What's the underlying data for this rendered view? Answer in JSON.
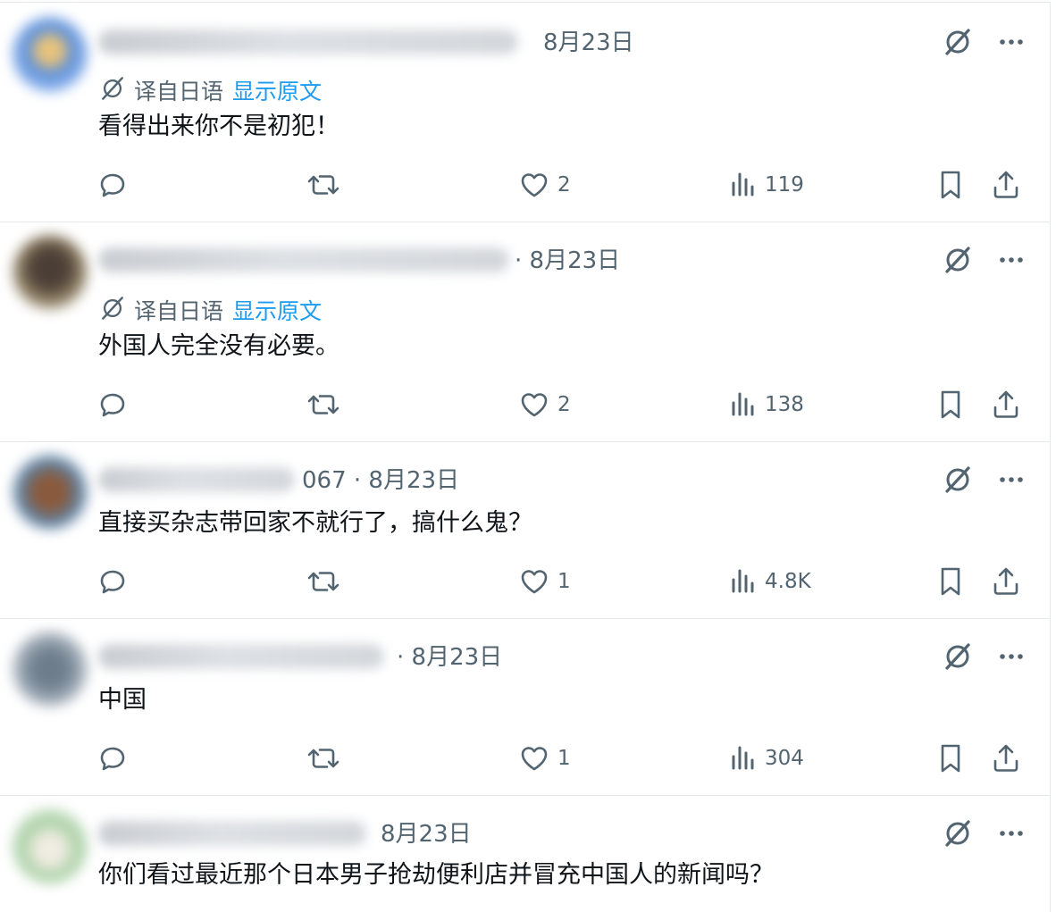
{
  "translation": {
    "label": "译自日语",
    "show_original": "显示原文"
  },
  "replies": [
    {
      "meta": "8月23日",
      "translated": true,
      "text": "看得出来你不是初犯！",
      "stats": {
        "replies": "",
        "reposts": "",
        "likes": "2",
        "views": "119"
      }
    },
    {
      "meta": "· 8月23日",
      "translated": true,
      "text": "外国人完全没有必要。",
      "stats": {
        "replies": "",
        "reposts": "",
        "likes": "2",
        "views": "138"
      }
    },
    {
      "meta": "067 · 8月23日",
      "translated": false,
      "text": "直接买杂志带回家不就行了，搞什么鬼？",
      "stats": {
        "replies": "",
        "reposts": "",
        "likes": "1",
        "views": "4.8K"
      }
    },
    {
      "meta": "· 8月23日",
      "translated": false,
      "text": "中国",
      "stats": {
        "replies": "",
        "reposts": "",
        "likes": "1",
        "views": "304"
      }
    },
    {
      "meta": "8月23日",
      "translated": false,
      "text": "你们看过最近那个日本男子抢劫便利店并冒充中国人的新闻吗？",
      "stats": {
        "replies": "",
        "reposts": "",
        "likes": "",
        "views": ""
      }
    }
  ],
  "colors": {
    "text_primary": "#0f1419",
    "text_secondary": "#536471",
    "link": "#1d9bf0",
    "divider": "#e6e9ec"
  },
  "icons": [
    "grok-icon",
    "more-icon",
    "translate-icon",
    "reply-icon",
    "repost-icon",
    "like-icon",
    "views-icon",
    "bookmark-icon",
    "share-icon"
  ]
}
